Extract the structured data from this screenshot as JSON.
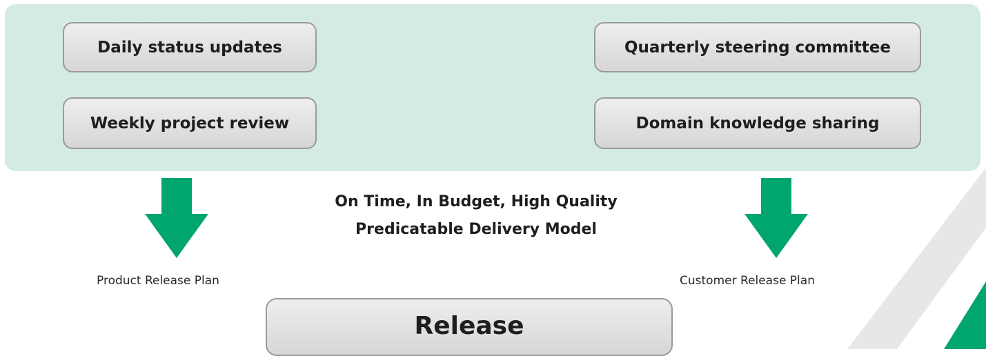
{
  "meetings": {
    "daily": "Daily status updates",
    "weekly": "Weekly project review",
    "quarterly": "Quarterly steering committee",
    "domain": "Domain knowledge sharing"
  },
  "tagline": {
    "line1": "On Time, In Budget, High Quality",
    "line2": "Predicatable Delivery Model"
  },
  "plans": {
    "product": "Product Release Plan",
    "customer": "Customer Release Plan"
  },
  "release": "Release",
  "colors": {
    "panel": "#d3ebe2",
    "arrow": "#00a66e",
    "box_border": "#9a9a9a",
    "text": "#1e1e1e"
  }
}
